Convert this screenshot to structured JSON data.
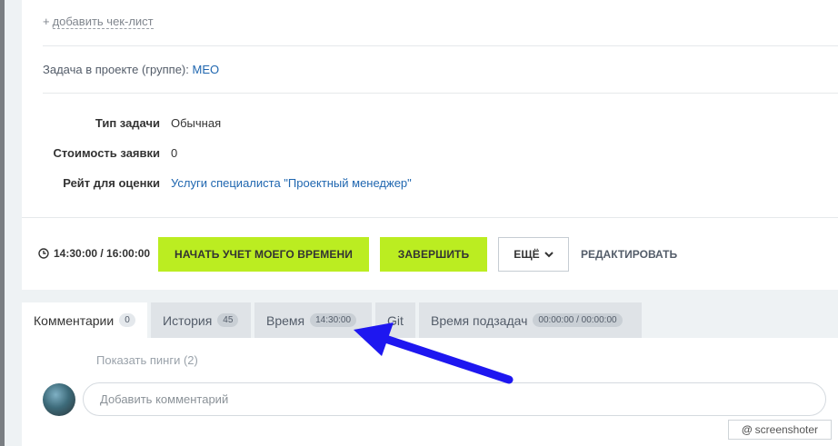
{
  "checklist": {
    "plus": "+",
    "label": "добавить чек-лист"
  },
  "project": {
    "prefix": "Задача в проекте (группе):",
    "name": "МЕО"
  },
  "properties": [
    {
      "label": "Тип задачи",
      "value": "Обычная",
      "is_link": false
    },
    {
      "label": "Стоимость заявки",
      "value": "0",
      "is_link": false
    },
    {
      "label": "Рейт для оценки",
      "value": "Услуги специалиста \"Проектный менеджер\"",
      "is_link": true
    }
  ],
  "timer": {
    "icon": "clock-icon",
    "value": "14:30:00 / 16:00:00"
  },
  "actions": {
    "start_label": "НАЧАТЬ УЧЕТ МОЕГО ВРЕМЕНИ",
    "finish_label": "ЗАВЕРШИТЬ",
    "more_label": "ЕЩЁ",
    "edit_label": "РЕДАКТИРОВАТЬ"
  },
  "tabs": [
    {
      "label": "Комментарии",
      "badge": "0",
      "active": true
    },
    {
      "label": "История",
      "badge": "45",
      "active": false
    },
    {
      "label": "Время",
      "badge": "14:30:00",
      "active": false
    },
    {
      "label": "Git",
      "badge": "",
      "active": false
    },
    {
      "label": "Время подзадач",
      "badge": "00:00:00 / 00:00:00",
      "active": false
    }
  ],
  "comments": {
    "pings_label": "Показать пинги (2)",
    "input_placeholder": "Добавить комментарий",
    "input_value": ""
  },
  "watermark": {
    "at": "@",
    "label": "screenshoter"
  },
  "colors": {
    "accent_green": "#bbed21",
    "link_blue": "#2067b0",
    "arrow_blue": "#1e17f0",
    "background": "#eef2f4"
  }
}
